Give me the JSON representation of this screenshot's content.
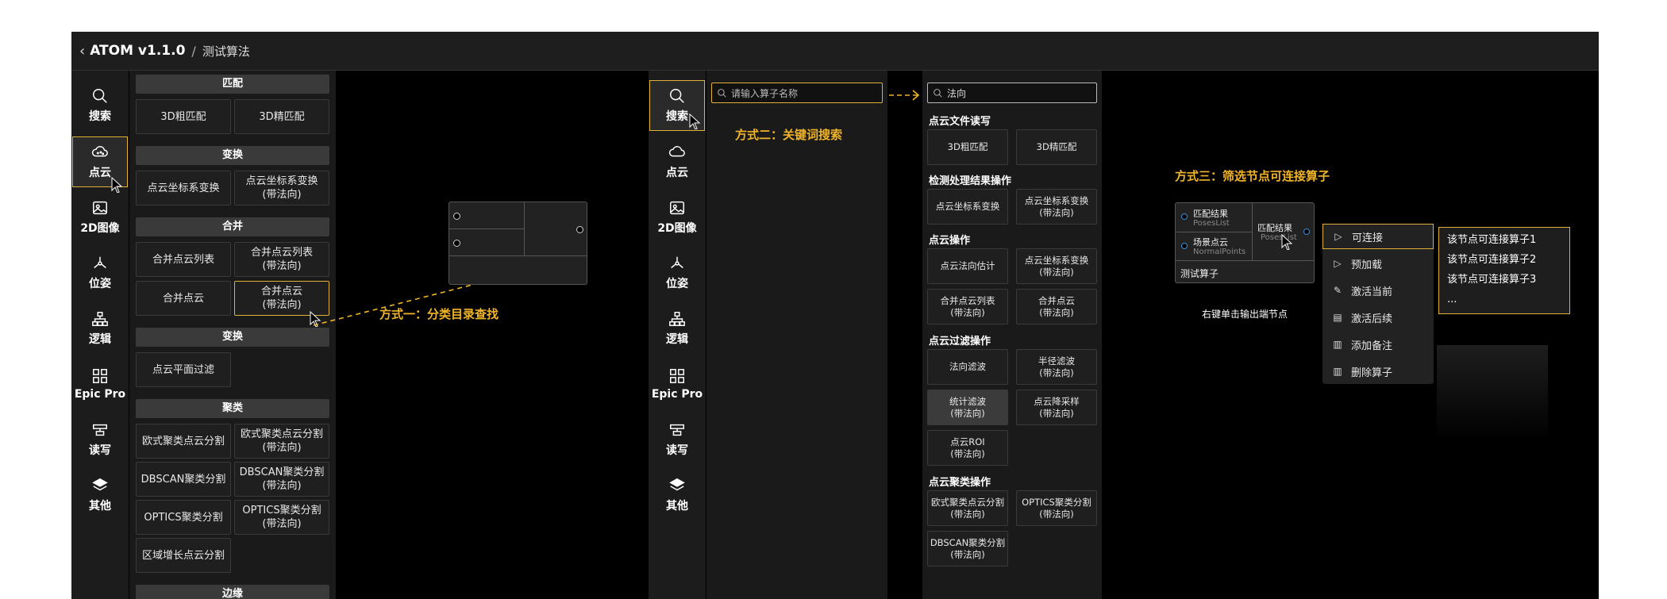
{
  "titlebar": {
    "back_icon": "chevron-left-icon",
    "app": "ATOM v1.1.0",
    "separator": "/",
    "page": "测试算法"
  },
  "rail": {
    "items": [
      {
        "label": "搜索",
        "icon": "search-icon"
      },
      {
        "label": "点云",
        "icon": "cloud-icon"
      },
      {
        "label": "2D图像",
        "icon": "image-icon"
      },
      {
        "label": "位姿",
        "icon": "pose-icon"
      },
      {
        "label": "逻辑",
        "icon": "logic-icon"
      },
      {
        "label": "Epic Pro",
        "icon": "grid-icon"
      },
      {
        "label": "读写",
        "icon": "io-icon"
      },
      {
        "label": "其他",
        "icon": "layers-icon"
      }
    ]
  },
  "categories": {
    "sections": [
      {
        "title": "匹配",
        "items": [
          "3D粗匹配",
          "3D精匹配"
        ]
      },
      {
        "title": "变换",
        "items": [
          "点云坐标系变换",
          "点云坐标系变换\n(带法向)"
        ]
      },
      {
        "title": "合并",
        "items": [
          "合并点云列表",
          "合并点云列表\n(带法向)",
          "合并点云",
          "合并点云\n(带法向)"
        ]
      },
      {
        "title": "变换",
        "items": [
          "点云平面过滤"
        ]
      },
      {
        "title": "聚类",
        "items": [
          "欧式聚类点云分割",
          "欧式聚类点云分割\n(带法向)",
          "DBSCAN聚类分割",
          "DBSCAN聚类分割\n(带法向)",
          "OPTICS聚类分割",
          "OPTICS聚类分割\n(带法向)",
          "区域增长点云分割"
        ]
      },
      {
        "title": "边缘",
        "items": []
      }
    ]
  },
  "annotations": {
    "method1": "方式一：分类目录查找",
    "method2": "方式二：关键词搜索",
    "method3": "方式三：筛选节点可连接算子",
    "right_click_hint": "右键单击输出端节点"
  },
  "search": {
    "placeholder": "请输入算子名称",
    "query": "法向"
  },
  "results": {
    "groups": [
      {
        "title": "点云文件读写",
        "items": [
          "3D粗匹配",
          "3D精匹配"
        ]
      },
      {
        "title": "检测处理结果操作",
        "items": [
          "点云坐标系变换",
          "点云坐标系变换\n(带法向)"
        ]
      },
      {
        "title": "点云操作",
        "items": [
          "点云法向估计",
          "点云坐标系变换\n(带法向)",
          "合并点云列表\n(带法向)",
          "合并点云\n(带法向)"
        ]
      },
      {
        "title": "点云过滤操作",
        "items": [
          "法向滤波",
          "半径滤波\n(带法向)",
          "统计滤波\n(带法向)",
          "点云降采样\n(带法向)",
          "点云ROI\n(带法向)"
        ]
      },
      {
        "title": "点云聚类操作",
        "items": [
          "欧式聚类点云分割\n(带法向)",
          "OPTICS聚类分割\n(带法向)",
          "DBSCAN聚类分割\n(带法向)"
        ]
      }
    ]
  },
  "node": {
    "inputs": [
      {
        "name": "匹配结果",
        "type": "PosesList"
      },
      {
        "name": "场景点云",
        "type": "NormalPoints"
      }
    ],
    "output": {
      "name": "匹配结果",
      "type": "PosesList"
    },
    "title": "测试算子"
  },
  "context_menu": {
    "items": [
      {
        "label": "可连接",
        "icon": "play-icon"
      },
      {
        "label": "预加载",
        "icon": "play-icon"
      },
      {
        "label": "激活当前",
        "icon": "edit-icon"
      },
      {
        "label": "激活后续",
        "icon": "file-icon"
      },
      {
        "label": "添加备注",
        "icon": "trash-icon"
      },
      {
        "label": "删除算子",
        "icon": "trash-icon"
      }
    ]
  },
  "submenu": {
    "items": [
      "该节点可连接算子1",
      "该节点可连接算子2",
      "该节点可连接算子3",
      "..."
    ]
  },
  "colors": {
    "accent": "#e0b13a",
    "annotation": "#f0b429",
    "port_blue": "#3a8fd8"
  }
}
